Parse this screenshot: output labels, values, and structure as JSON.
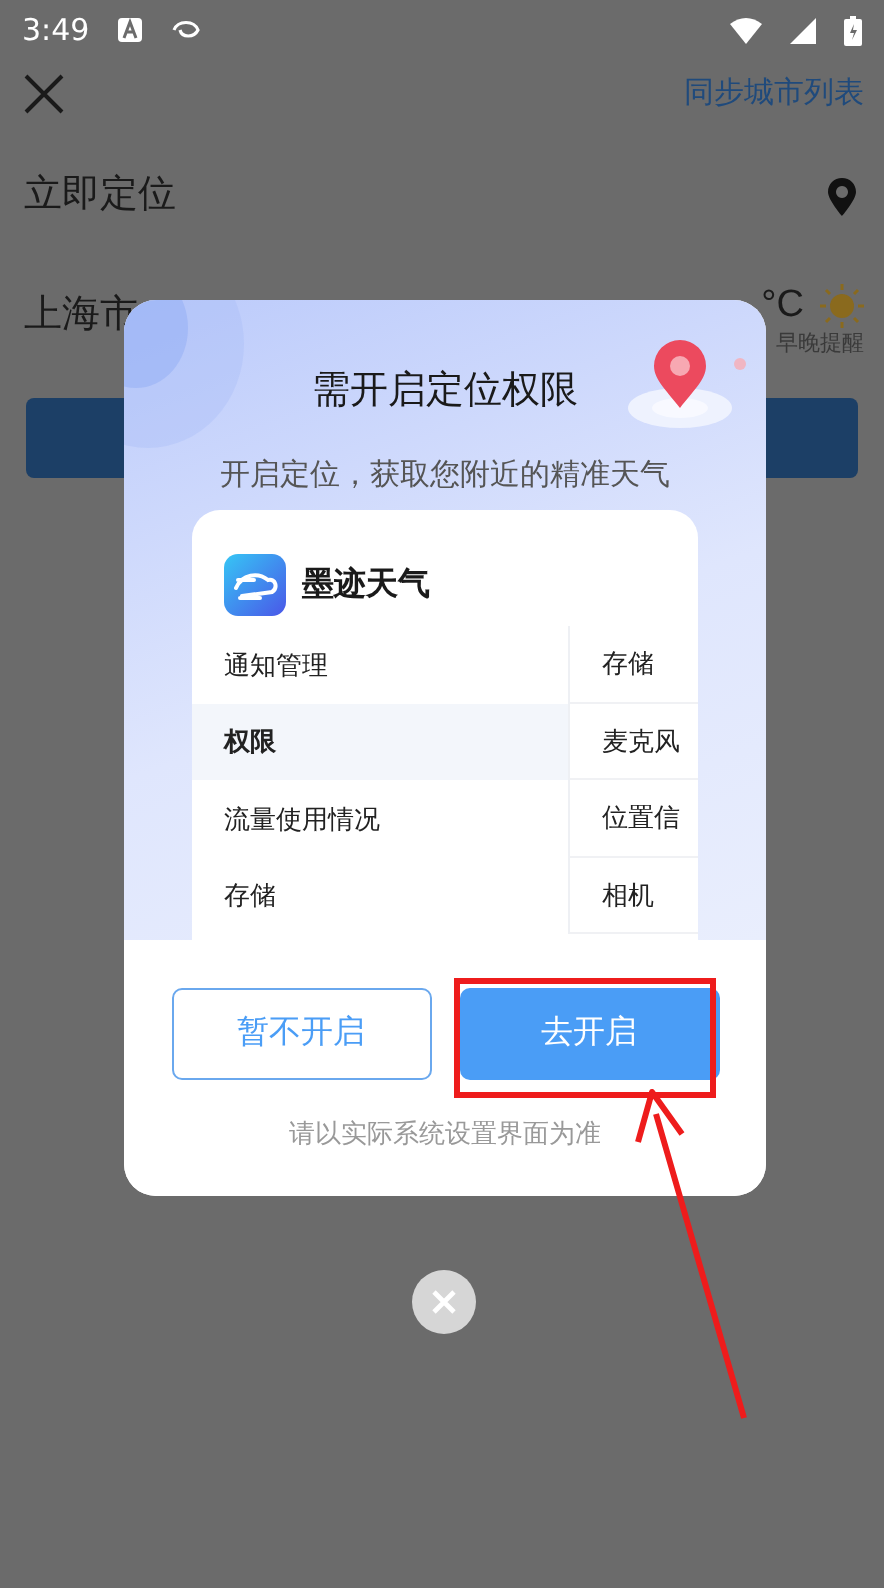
{
  "status_bar": {
    "time": "3:49"
  },
  "header": {
    "sync_link": "同步城市列表"
  },
  "locate_row": {
    "label": "立即定位"
  },
  "city_row": {
    "city": "上海市",
    "temperature": "°C",
    "reminder": "早晚提醒"
  },
  "dialog": {
    "title": "需开启定位权限",
    "subtitle": "开启定位，获取您附近的精准天气",
    "preview": {
      "app_name": "墨迹天气",
      "left_items": [
        {
          "label": "通知管理",
          "selected": false
        },
        {
          "label": "权限",
          "selected": true
        },
        {
          "label": "流量使用情况",
          "selected": false
        },
        {
          "label": "存储",
          "selected": false
        }
      ],
      "right_items": [
        {
          "label": "存储"
        },
        {
          "label": "麦克风"
        },
        {
          "label": "位置信"
        },
        {
          "label": "相机"
        }
      ]
    },
    "buttons": [
      {
        "label": "暂不开启",
        "kind": "secondary"
      },
      {
        "label": "去开启",
        "kind": "primary"
      }
    ],
    "footnote": "请以实际系统设置界面为准"
  },
  "annotation": {
    "highlight_box": true,
    "arrow": true
  }
}
